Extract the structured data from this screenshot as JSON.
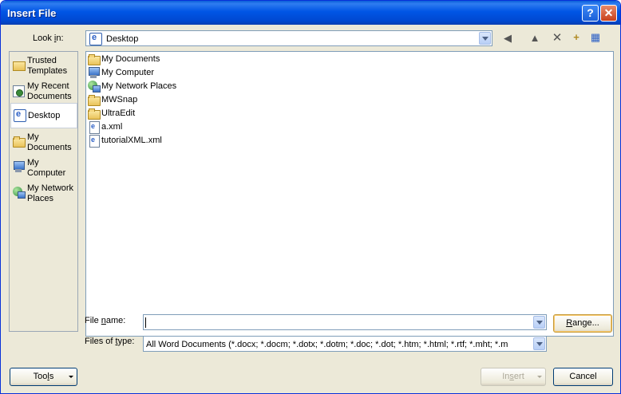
{
  "window": {
    "title": "Insert File",
    "help_glyph": "?",
    "close_glyph": "✕"
  },
  "lookin": {
    "label_pre": "Look ",
    "label_acc": "i",
    "label_post": "n:",
    "value": "Desktop"
  },
  "places": [
    {
      "line1": "Trusted",
      "line2": "Templates",
      "icon": "templates-icon"
    },
    {
      "line1": "My Recent",
      "line2": "Documents",
      "icon": "recent-documents-icon"
    },
    {
      "line1": "Desktop",
      "line2": "",
      "icon": "desktop-icon",
      "selected": true
    },
    {
      "line1": "My",
      "line2": "Documents",
      "icon": "folder-icon"
    },
    {
      "line1": "My",
      "line2": "Computer",
      "icon": "computer-icon"
    },
    {
      "line1": "My Network",
      "line2": "Places",
      "icon": "network-icon"
    }
  ],
  "files": [
    {
      "name": "My Documents",
      "icon": "folder-icon"
    },
    {
      "name": "My Computer",
      "icon": "computer-icon"
    },
    {
      "name": "My Network Places",
      "icon": "network-icon"
    },
    {
      "name": "MWSnap",
      "icon": "folder-icon"
    },
    {
      "name": "UltraEdit",
      "icon": "folder-icon"
    },
    {
      "name": "a.xml",
      "icon": "xml-file-icon"
    },
    {
      "name": "tutorialXML.xml",
      "icon": "xml-file-icon"
    }
  ],
  "filename": {
    "label_pre": "File ",
    "label_acc": "n",
    "label_post": "ame:",
    "value": ""
  },
  "filetype": {
    "label_pre": "Files of ",
    "label_acc": "t",
    "label_post": "ype:",
    "value": "All Word Documents (*.docx; *.docm; *.dotx; *.dotm; *.doc; *.dot; *.htm; *.html; *.rtf; *.mht; *.m"
  },
  "buttons": {
    "range_acc": "R",
    "range_post": "ange...",
    "tools_pre": "Too",
    "tools_acc": "l",
    "tools_post": "s",
    "insert_pre": "In",
    "insert_acc": "s",
    "insert_post": "ert",
    "cancel": "Cancel"
  },
  "toolbar": {
    "back_glyph": "◀",
    "up_glyph": "▲",
    "delete_glyph": "✕",
    "newfolder_glyph": "+",
    "views_glyph": "▦"
  }
}
